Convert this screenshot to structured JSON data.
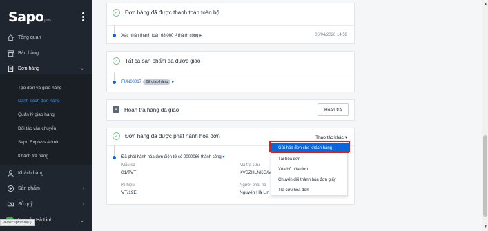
{
  "sidebar": {
    "logo_main": "Sapo",
    "logo_sub": "pos",
    "items": [
      {
        "label": "Tổng quan",
        "icon": "home-icon"
      },
      {
        "label": "Bán hàng",
        "icon": "store-icon"
      },
      {
        "label": "Đơn hàng",
        "icon": "document-icon"
      },
      {
        "label": "Khách hàng",
        "icon": "user-icon"
      },
      {
        "label": "Sản phẩm",
        "icon": "box-icon"
      },
      {
        "label": "Sổ quỹ",
        "icon": "cash-icon"
      }
    ],
    "sub_items": [
      "Tạo đơn và giao hàng",
      "Danh sách đơn hàng",
      "Quản lý giao hàng",
      "Đối tác vận chuyển",
      "Sapo Express Admin",
      "Khách trả hàng"
    ],
    "user_initials": "NH",
    "user_name": "Nguyễn Hà Linh",
    "status_url": "javascript:void(0)"
  },
  "cards": {
    "payment": {
      "title": "Đơn hàng đã được thanh toán toàn bộ",
      "event_text": "Xác nhận thanh toán 68.000 ₫ thành công",
      "event_time": "06/04/2020 14:59"
    },
    "delivered": {
      "title": "Tất cả sản phẩm đã được giao",
      "fulfillment_code": "FUN00017",
      "badge": "Đã giao hàng"
    },
    "returns": {
      "title": "Hoàn trả hàng đã giao",
      "button": "Hoàn trả"
    },
    "invoice": {
      "title": "Đơn hàng đã được phát hành hóa đơn",
      "more_actions": "Thao tác khác",
      "event_text": "Đã phát hành hóa đơn điện tử số 0000066 thành công",
      "fields": {
        "form_no_label": "Mẫu số",
        "form_no_value": "01/TVT",
        "lookup_label": "Mã tra cứu",
        "lookup_value": "KVSZHLNKG/M",
        "symbol_label": "Kí hiệu",
        "symbol_value": "VT/19E",
        "issuer_label": "Người phát hà",
        "issuer_value": "Nguyễn Hà Lin"
      }
    }
  },
  "dropdown": {
    "items": [
      "Gửi hóa đơn cho khách hàng",
      "Tải hóa đơn",
      "Xóa bỏ hóa đơn",
      "Chuyển đổi thành hóa đơn giấy",
      "Tra cứu hóa đơn"
    ]
  },
  "colors": {
    "sidebar_bg": "#20262f",
    "accent_blue": "#0a66d9",
    "success_green": "#5cb874",
    "highlight_red": "#e02020"
  }
}
